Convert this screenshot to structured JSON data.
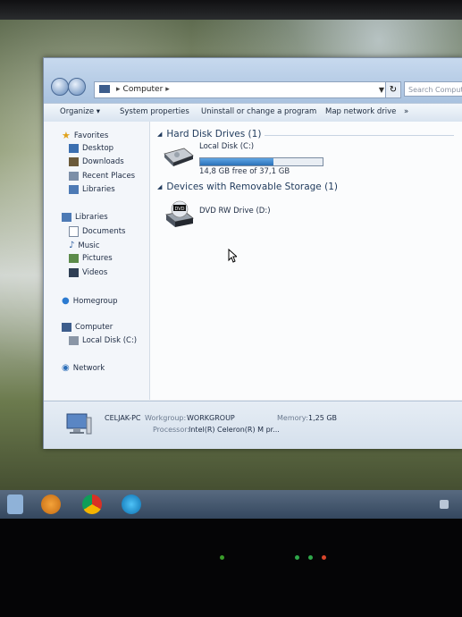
{
  "window": {
    "address": {
      "segments": [
        "Computer"
      ],
      "separator": "▸"
    },
    "search_placeholder": "Search Computer"
  },
  "toolbar": {
    "organize": "Organize ▾",
    "system_properties": "System properties",
    "uninstall": "Uninstall or change a program",
    "map_network_drive": "Map network drive",
    "more": "»"
  },
  "navpane": {
    "favorites": {
      "label": "Favorites",
      "items": [
        "Desktop",
        "Downloads",
        "Recent Places",
        "Libraries"
      ]
    },
    "libraries": {
      "label": "Libraries",
      "items": [
        "Documents",
        "Music",
        "Pictures",
        "Videos"
      ]
    },
    "homegroup": "Homegroup",
    "computer": {
      "label": "Computer",
      "items": [
        "Local Disk (C:)"
      ]
    },
    "network": "Network"
  },
  "content": {
    "hard_disk_group": {
      "title": "Hard Disk Drives (1)"
    },
    "local_disk": {
      "name": "Local Disk (C:)",
      "free_text": "14,8 GB free of 37,1 GB",
      "used_fraction": 0.6
    },
    "removable_group": {
      "title": "Devices with Removable Storage (1)"
    },
    "dvd": {
      "name": "DVD RW Drive (D:)",
      "badge": "DVD"
    }
  },
  "details": {
    "pc_name": "CELJAK-PC",
    "workgroup_label": "Workgroup:",
    "workgroup_value": "WORKGROUP",
    "memory_label": "Memory:",
    "memory_value": "1,25 GB",
    "processor_label": "Processor:",
    "processor_value": "Intel(R) Celeron(R) M pr..."
  },
  "colors": {
    "accent": "#2a71b8",
    "window_frame": "#a9c2df"
  }
}
